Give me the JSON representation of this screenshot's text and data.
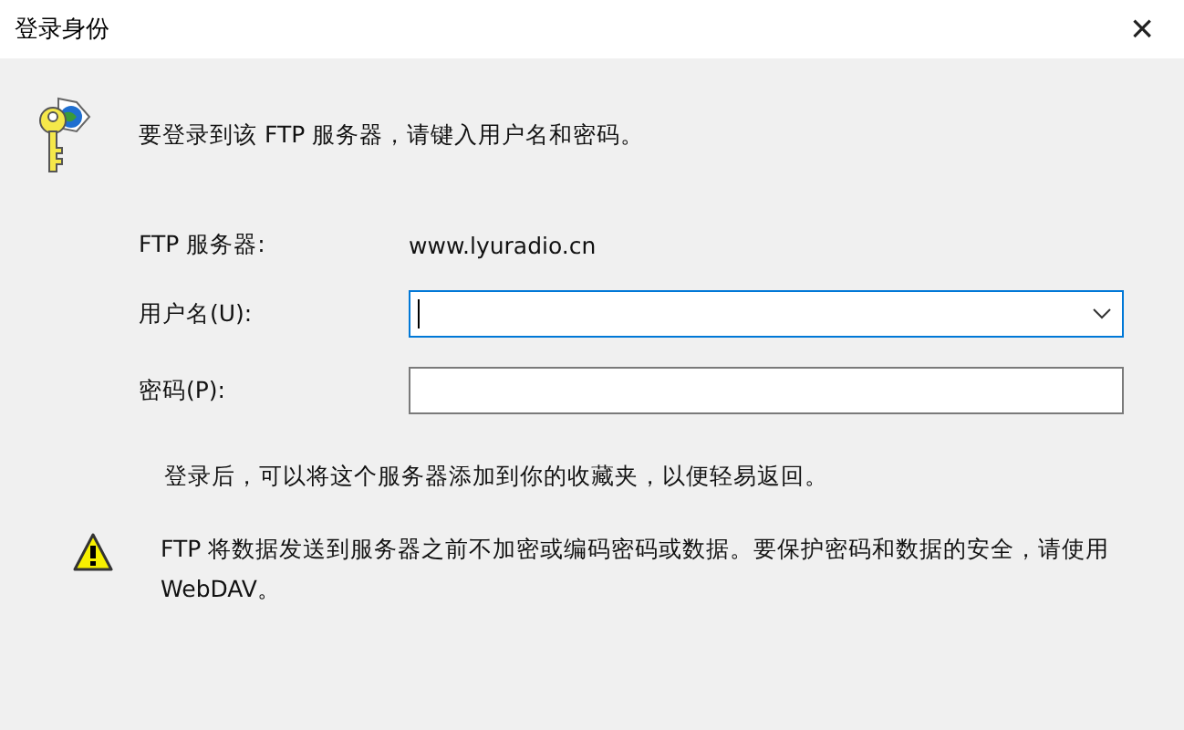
{
  "window": {
    "title": "登录身份",
    "close": "×"
  },
  "intro": "要登录到该 FTP 服务器，请键入用户名和密码。",
  "server": {
    "label": "FTP 服务器:",
    "value": "www.lyuradio.cn"
  },
  "fields": [
    {
      "label": "用户名(U):",
      "kind": "combo",
      "focused": true
    },
    {
      "label": "密码(P):",
      "kind": "text",
      "focused": false
    }
  ],
  "note": "登录后，可以将这个服务器添加到你的收藏夹，以便轻易返回。",
  "warning": "FTP 将数据发送到服务器之前不加密或编码密码或数据。要保护密码和数据的安全，请使用 WebDAV。"
}
